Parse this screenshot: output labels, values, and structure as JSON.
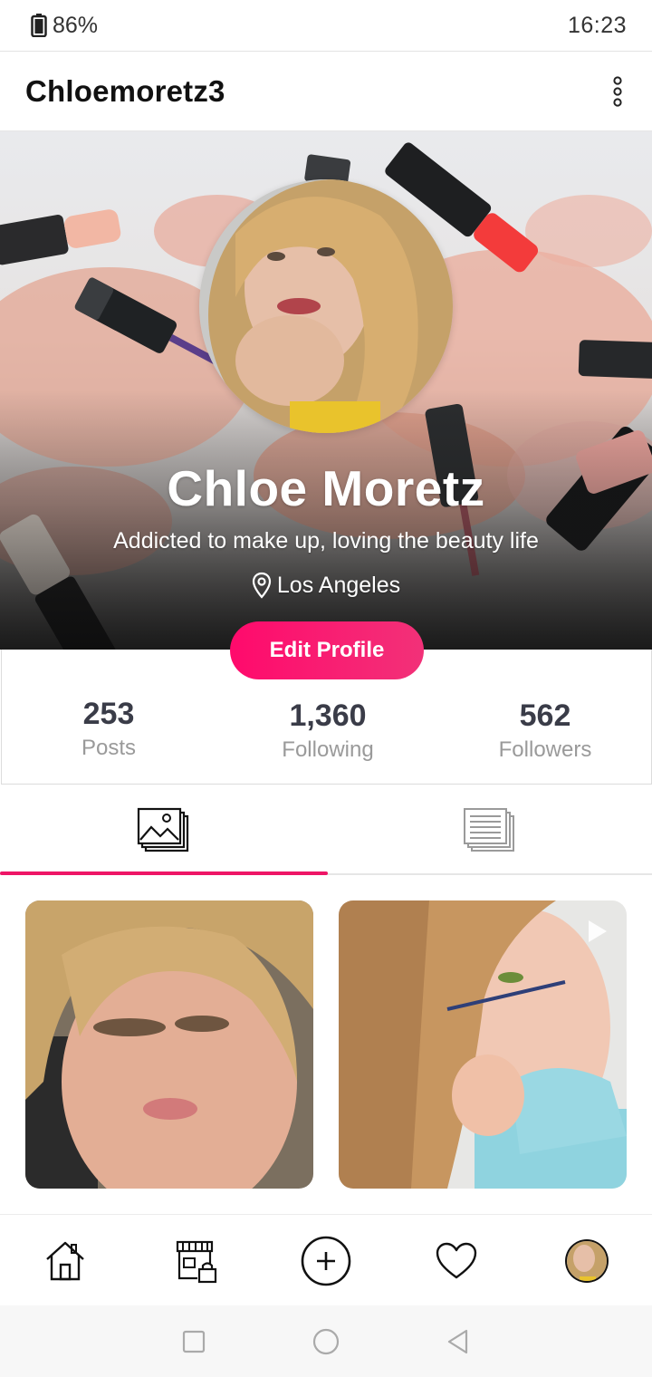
{
  "status_bar": {
    "battery": "86%",
    "time": "16:23"
  },
  "header": {
    "username": "Chloemoretz3"
  },
  "profile": {
    "name": "Chloe Moretz",
    "bio": "Addicted to make up, loving the beauty life",
    "location": "Los Angeles",
    "edit_label": "Edit Profile"
  },
  "stats": [
    {
      "value": "253",
      "label": "Posts"
    },
    {
      "value": "1,360",
      "label": "Following"
    },
    {
      "value": "562",
      "label": "Followers"
    }
  ],
  "tabs": [
    {
      "icon": "photos-grid-icon",
      "active": true
    },
    {
      "icon": "articles-list-icon",
      "active": false
    }
  ],
  "posts": [
    {
      "type": "photo"
    },
    {
      "type": "video"
    }
  ],
  "bottom_nav": [
    "home-icon",
    "shop-icon",
    "add-icon",
    "heart-icon",
    "profile-avatar"
  ],
  "colors": {
    "accent": "#ee1566",
    "button_start": "#ff0a6c",
    "button_end": "#f23178",
    "stat_value": "#3a3c48"
  }
}
